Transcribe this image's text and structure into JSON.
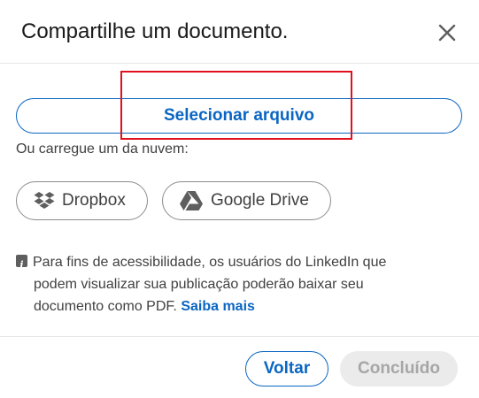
{
  "dialog": {
    "title": "Compartilhe um documento.",
    "close_icon": "close-icon"
  },
  "upload": {
    "select_file_label": "Selecionar arquivo",
    "cloud_label": "Ou carregue um da nuvem:",
    "cloud_options": [
      {
        "label": "Dropbox",
        "icon": "dropbox-icon"
      },
      {
        "label": "Google Drive",
        "icon": "google-drive-icon"
      }
    ]
  },
  "accessibility_note": {
    "icon": "info-icon",
    "line1": "Para fins de acessibilidade, os usuários do LinkedIn que",
    "line2": "podem visualizar sua publicação poderão baixar seu",
    "line3": "documento como PDF.",
    "link": "Saiba mais"
  },
  "footer": {
    "back_label": "Voltar",
    "done_label": "Concluído",
    "done_disabled": true
  },
  "colors": {
    "accent": "#0a66c2",
    "highlight": "#e0101c",
    "disabled_bg": "#ebebeb",
    "disabled_text": "#a6a6a6"
  }
}
